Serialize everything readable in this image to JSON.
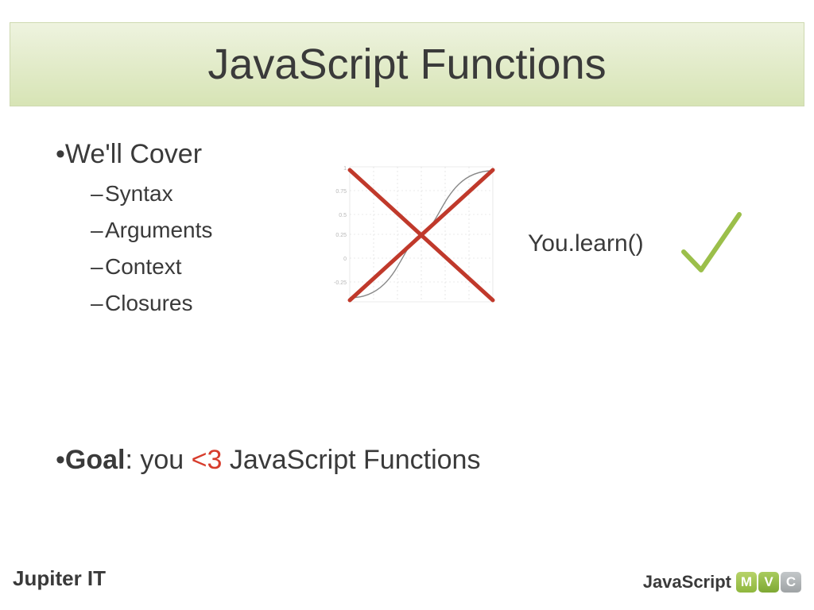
{
  "title": "JavaScript Functions",
  "cover_heading": "We'll Cover",
  "cover_items": [
    "Syntax",
    "Arguments",
    "Context",
    "Closures"
  ],
  "goal": {
    "label": "Goal",
    "before": ": you ",
    "heart": "<3",
    "after": " JavaScript Functions"
  },
  "you_learn": "You.learn()",
  "footer_left": "Jupiter IT",
  "footer_right_js": "JavaScript",
  "mvc": {
    "m": "M",
    "v": "V",
    "c": "C"
  },
  "colors": {
    "title_bg_top": "#eef3df",
    "title_bg_bottom": "#d7e4b5",
    "accent_red": "#c0392b",
    "check_green": "#9bbf4a"
  }
}
